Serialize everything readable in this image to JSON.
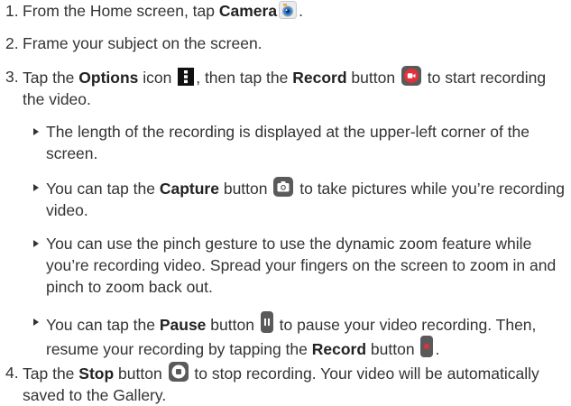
{
  "steps": [
    {
      "number": "1.",
      "pre": "From the Home screen, tap ",
      "bold": "Camera",
      "icon": "camera-app-icon",
      "post": "."
    },
    {
      "number": "2.",
      "text": "Frame your subject on the screen."
    },
    {
      "number": "3.",
      "pre": "Tap the ",
      "bold1": "Options",
      "mid1": " icon ",
      "icon1": "options-menu-icon",
      "mid2": ", then tap the ",
      "bold2": "Record",
      "mid3": " button ",
      "icon2": "record-button-icon",
      "post": " to start recording the video."
    },
    {
      "number": "4.",
      "pre": "Tap the ",
      "bold": "Stop",
      "mid": " button ",
      "icon": "stop-button-icon",
      "post": " to stop recording. Your video will be automatically saved to the Gallery."
    }
  ],
  "bullets": [
    {
      "text": "The length of the recording is displayed at the upper-left corner of the screen."
    },
    {
      "pre": "You can tap the ",
      "bold": "Capture",
      "mid": " button ",
      "icon": "capture-button-icon",
      "post": " to take pictures while you’re recording video."
    },
    {
      "text": "You can use the pinch gesture to use the dynamic zoom feature while you’re recording video. Spread your fingers on the screen to zoom in and pinch to zoom back out."
    },
    {
      "pre": "You can tap the ",
      "bold1": "Pause",
      "mid1": " button ",
      "icon1": "pause-button-icon",
      "mid2": " to pause your video recording. Then, resume your recording by tapping the ",
      "bold2": "Record",
      "mid3": " button ",
      "icon2": "record-resume-button-icon",
      "post": "."
    }
  ],
  "colors": {
    "text": "#333333",
    "button_gray": "#5a5a5a",
    "record_red": "#e2313c",
    "camera_blue": "#2f7fd6",
    "camera_orange": "#f3a537"
  }
}
